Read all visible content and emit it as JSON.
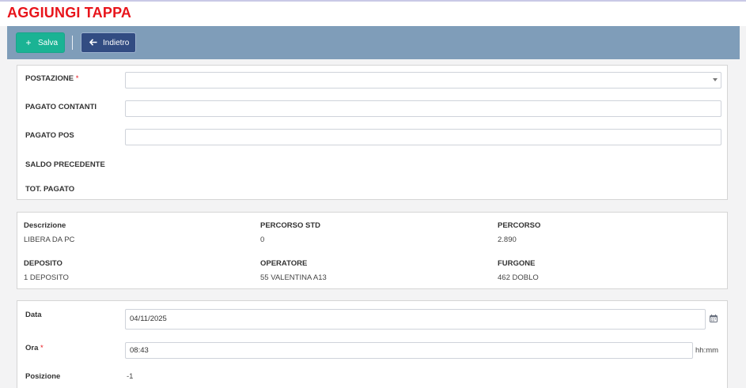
{
  "header": {
    "title": "AGGIUNGI TAPPA"
  },
  "toolbar": {
    "save_label": "Salva",
    "back_label": "Indietro",
    "save_icon": "plus-icon",
    "back_icon": "arrow-left-icon"
  },
  "form": {
    "postazione_label": "POSTAZIONE",
    "postazione_value": "",
    "pagato_contanti_label": "PAGATO CONTANTI",
    "pagato_contanti_value": "",
    "pagato_pos_label": "PAGATO POS",
    "pagato_pos_value": "",
    "saldo_precedente_label": "SALDO PRECEDENTE",
    "tot_pagato_label": "TOT. PAGATO",
    "required_mark": "*"
  },
  "info": [
    {
      "label": "Descrizione",
      "value": "LIBERA DA PC"
    },
    {
      "label": "PERCORSO STD",
      "value": "0"
    },
    {
      "label": "PERCORSO",
      "value": "2.890"
    },
    {
      "label": "DEPOSITO",
      "value": "1 DEPOSITO"
    },
    {
      "label": "OPERATORE",
      "value": "55 VALENTINA A13"
    },
    {
      "label": "FURGONE",
      "value": "462 DOBLO"
    }
  ],
  "details": {
    "data_label": "Data",
    "data_value": "04/11/2025",
    "ora_label": "Ora",
    "ora_value": "08:43",
    "ora_suffix": "hh:mm",
    "posizione_label": "Posizione",
    "posizione_value": "-1",
    "calendar_icon": "calendar-icon"
  },
  "colors": {
    "title": "#e8141b",
    "toolbar": "#7f9db9",
    "save_button": "#1ab394",
    "back_button": "#324c82"
  }
}
